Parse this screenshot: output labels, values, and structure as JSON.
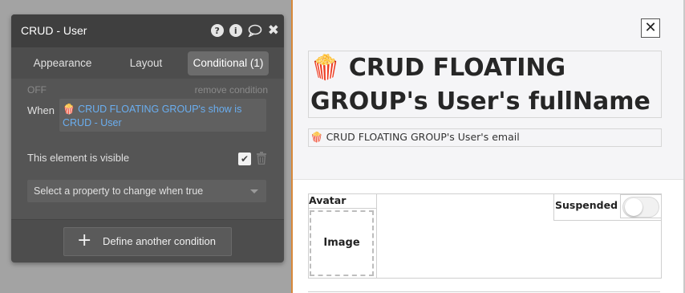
{
  "panel": {
    "title": "CRUD - User",
    "icons": [
      "help-icon",
      "info-icon",
      "comment-icon",
      "close-icon"
    ],
    "help_glyph": "?",
    "info_glyph": "i",
    "close_glyph": "✖",
    "tabs": [
      {
        "label": "Appearance",
        "active": false
      },
      {
        "label": "Layout",
        "active": false
      },
      {
        "label": "Conditional (1)",
        "active": true
      }
    ],
    "condition": {
      "status": "OFF",
      "remove_label": "remove condition",
      "when_label": "When",
      "expression_icon": "🍿",
      "expression": "CRUD FLOATING GROUP's show is CRUD - User",
      "property_label": "This element is visible",
      "property_checked": true,
      "check_glyph": "✔",
      "select_placeholder": "Select a property to change when true"
    },
    "define_button": {
      "plus": "+",
      "label": "Define another condition"
    }
  },
  "canvas": {
    "close_glyph": "✕",
    "name_icon": "🍿",
    "name_text": "CRUD FLOATING GROUP's User's fullName",
    "email_icon": "🍿",
    "email_text": "CRUD FLOATING GROUP's User's email",
    "avatar_label": "Avatar",
    "image_placeholder": "Image",
    "suspended_label": "Suspended",
    "suspended_toggle_on": false
  },
  "colors": {
    "panel_bg": "#4d4d4d",
    "header_bg": "#3f3f3f",
    "dynamic_expression": "#6aaef0",
    "canvas_selection_border": "#d8893a"
  }
}
